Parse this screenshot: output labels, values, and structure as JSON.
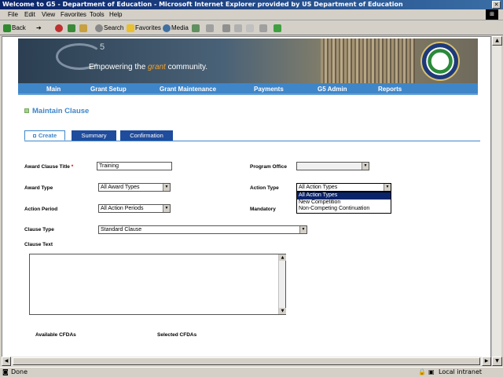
{
  "window": {
    "title": "Welcome to G5 - Department of Education - Microsoft Internet Explorer provided by US Department of Education",
    "close_glyph": "✕"
  },
  "menu": [
    "File",
    "Edit",
    "View",
    "Favorites",
    "Tools",
    "Help"
  ],
  "toolbar": {
    "back": "Back",
    "search": "Search",
    "favorites": "Favorites",
    "media": "Media"
  },
  "banner": {
    "logo_superscript": "5",
    "tagline_pre": "Empowering the ",
    "tagline_highlight": "grant",
    "tagline_post": " community."
  },
  "nav": [
    "Main",
    "Grant Setup",
    "Grant Maintenance",
    "Payments",
    "G5 Admin",
    "Reports"
  ],
  "page": {
    "title": "Maintain Clause",
    "tabs": [
      "Create",
      "Summary",
      "Confirmation"
    ]
  },
  "form": {
    "award_clause_title_label": "Award Clause Title",
    "required_mark": "*",
    "award_clause_title_value": "Training",
    "program_office_label": "Program Office",
    "program_office_value": "",
    "award_type_label": "Award Type",
    "award_type_value": "All Award Types",
    "action_type_label": "Action Type",
    "action_type_value": "All Action Types",
    "action_type_options": [
      "All Action Types",
      "New Competition",
      "Non-Competing Continuation"
    ],
    "action_period_label": "Action Period",
    "action_period_value": "All Action Periods",
    "mandatory_label": "Mandatory",
    "clause_type_label": "Clause Type",
    "clause_type_value": "Standard Clause",
    "clause_text_label": "Clause Text",
    "clause_text_value": "",
    "available_cfdas_label": "Available CFDAs",
    "selected_cfdas_label": "Selected CFDAs"
  },
  "status": {
    "left": "Done",
    "zone": "Local intranet"
  }
}
